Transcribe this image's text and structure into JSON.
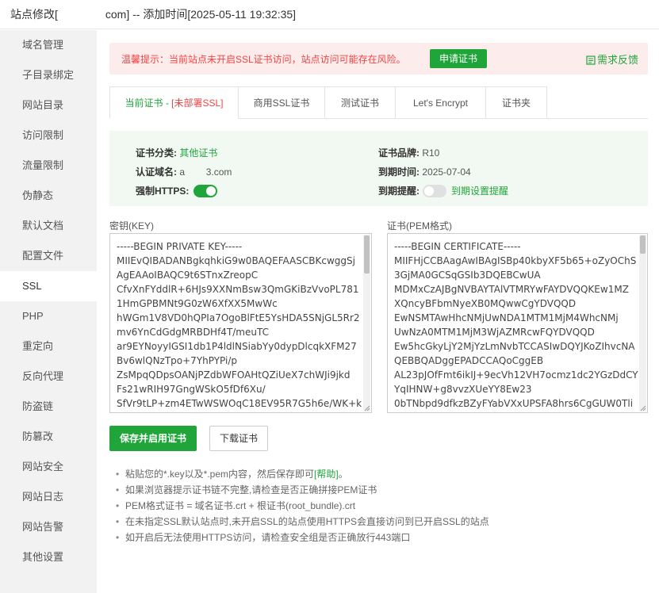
{
  "window": {
    "title_prefix": "站点修改[",
    "title_visible_domain_end": "com] -- 添加时间[2025-05-11 19:32:35]"
  },
  "sidebar": {
    "items": [
      {
        "label": "域名管理"
      },
      {
        "label": "子目录绑定"
      },
      {
        "label": "网站目录"
      },
      {
        "label": "访问限制"
      },
      {
        "label": "流量限制"
      },
      {
        "label": "伪静态"
      },
      {
        "label": "默认文档"
      },
      {
        "label": "配置文件"
      },
      {
        "label": "SSL"
      },
      {
        "label": "PHP"
      },
      {
        "label": "重定向"
      },
      {
        "label": "反向代理"
      },
      {
        "label": "防盗链"
      },
      {
        "label": "防篡改"
      },
      {
        "label": "网站安全"
      },
      {
        "label": "网站日志"
      },
      {
        "label": "网站告警"
      },
      {
        "label": "其他设置"
      }
    ],
    "active": "SSL"
  },
  "alert": {
    "message": "温馨提示：当前站点未开启SSL证书访问，站点访问可能存在风险。",
    "apply_button": "申请证书",
    "feedback_link": "需求反馈",
    "colors": {
      "danger": "#ef4444",
      "accent": "#20a53a"
    }
  },
  "tabs": {
    "current_prefix": "当前证书 - ",
    "current_status": "[未部署SSL]",
    "commercial": "商用SSL证书",
    "test": "测试证书",
    "letsencrypt": "Let's Encrypt",
    "folder": "证书夹"
  },
  "cert_info": {
    "category_label": "证书分类:",
    "category_value": "其他证书",
    "brand_label": "证书品牌:",
    "brand_value": "R10",
    "domain_label": "认证域名:",
    "domain_value": "a        3.com",
    "expire_label": "到期时间:",
    "expire_value": "2025-07-04",
    "force_https_label": "强制HTTPS:",
    "force_https_on": true,
    "remind_label": "到期提醒:",
    "remind_on": false,
    "remind_link": "到期设置提醒"
  },
  "key": {
    "label": "密钥(KEY)",
    "content": "-----BEGIN PRIVATE KEY-----\nMIIEvQIBADANBgkqhkiG9w0BAQEFAASCBKcwggSj\nAgEAAoIBAQC9t6STnxZreopC\nCfvXnFYddlR+6HJs9XXNmBsw3QmGKiBzVvoPL781\n1HmGPBMNt9G0zW6XfXX5MwWc\nhWGm1V8VD0hQPIa7OgoBlFtE5YsHDA5SNjGL5Rr2\nmv6YnCdGdgMRBDHf4T/meuTC\nar9EYNoyyIGSI1db1P4ldlNSiabYy0dypDlcqkXFM27\nBv6wlQNzTpo+7YhPYPi/p\nZsMpqQDpsOANjPZdbWFOAHtQZiUeX7chWJi9jkd\nFs21wRIH97GngWSkO5fDf6Xu/\nSfVr9tLP+zm4ETwWSWOqC18EV95R7G5h6e/WK+k"
  },
  "cert": {
    "label": "证书(PEM格式)",
    "content": "-----BEGIN CERTIFICATE-----\nMIIFHjCCBAagAwIBAgISBp40kbyXF5b65+oZyOChS\n3GjMA0GCSqGSIb3DQEBCwUA\nMDMxCzAJBgNVBAYTAlVTMRYwFAYDVQQKEw1MZ\nXQncyBFbmNyeXB0MQwwCgYDVQQD\nEwNSMTAwHhcNMjUwNDA1MTM1MjM4WhcNMj\nUwNzA0MTM1MjM3WjAZMRcwFQYDVQQD\nEw5hcGkyLjY2MjYzLmNvbTCCASIwDQYJKoZIhvcNA\nQEBBQADggEPADCCAQoCggEB\nAL23pJOfFmt6ikIJ+9ecVh12VH7ocmz1dc2YGzDdCY\nYqIHNW+g8vvzXUeYY8Ew23\n0bTNbpd9dfkzBZyFYabVXxUPSFA8hrs6CgGUW0Tli"
  },
  "actions": {
    "save": "保存并启用证书",
    "download": "下载证书"
  },
  "tips": {
    "tip1_prefix": "粘贴您的*.key以及*.pem内容，然后保存即可",
    "tip1_help": "[帮助]",
    "tip1_suffix": "。",
    "tip2": "如果浏览器提示证书链不完整,请检查是否正确拼接PEM证书",
    "tip3": "PEM格式证书 = 域名证书.crt + 根证书(root_bundle).crt",
    "tip4": "在未指定SSL默认站点时,未开启SSL的站点使用HTTPS会直接访问到已开启SSL的站点",
    "tip5": "如开启后无法使用HTTPS访问，请检查安全组是否正确放行443端口"
  }
}
